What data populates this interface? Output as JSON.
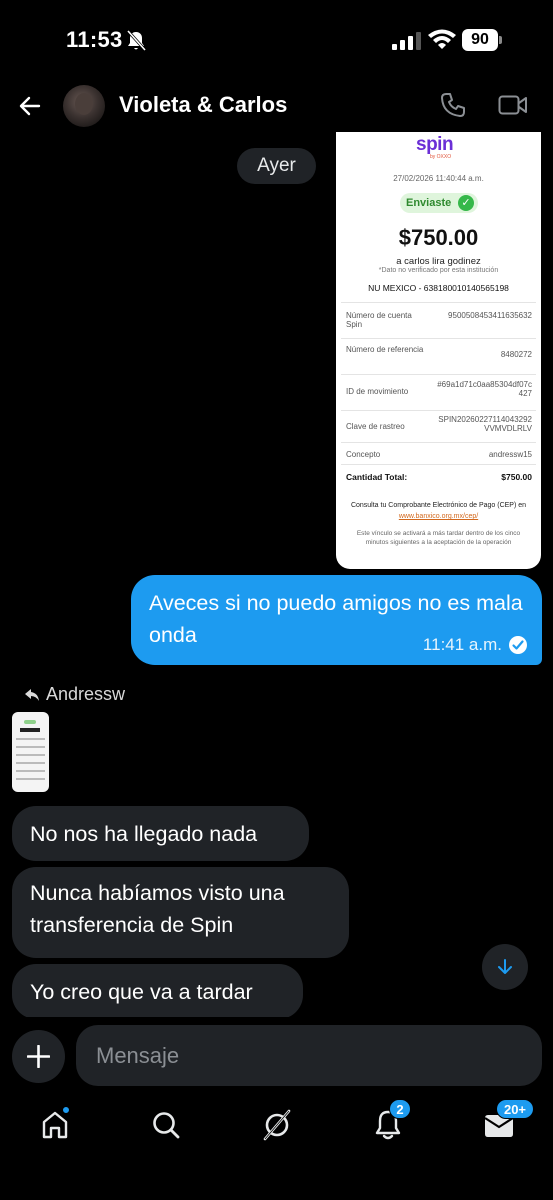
{
  "status": {
    "time": "11:53",
    "battery": "90"
  },
  "header": {
    "title": "Violeta & Carlos"
  },
  "chat": {
    "date_separator": "Ayer",
    "receipt": {
      "logo": "spin",
      "logo_sub": "by OXXO",
      "datetime": "27/02/2026 11:40:44 a.m.",
      "status": "Enviaste",
      "amount": "$750.00",
      "recipient": "a carlos lira godinez",
      "note": "*Dato no verificado por esta institución",
      "bank": "NU MEXICO - 638180010140565198",
      "rows": [
        {
          "key": "Número de cuenta Spin",
          "value": "9500508453411635632"
        },
        {
          "key": "Número de referencia",
          "value": "8480272"
        },
        {
          "key": "ID de movimiento",
          "value": "#69a1d71c0aa85304df07c427"
        },
        {
          "key": "Clave de rastreo",
          "value": "SPIN20260227114043292VVMVDLRLV"
        },
        {
          "key": "Concepto",
          "value": "andressw15"
        }
      ],
      "total_label": "Cantidad Total:",
      "total_value": "$750.00",
      "consult_text": "Consulta tu Comprobante Electrónico de Pago (CEP) en",
      "consult_link": "www.banxico.org.mx/cep/",
      "footer": "Este vínculo se activará a más tardar dentro de los cinco minutos siguientes a la aceptación de la operación"
    },
    "outgoing": {
      "text": "Aveces si no puedo amigos no es mala onda",
      "time": "11:41 a.m."
    },
    "reply_label": "Andressw",
    "incoming": [
      "No nos ha llegado nada",
      "Nunca habíamos visto una transferencia de Spin",
      "Yo creo que va a tardar"
    ]
  },
  "composer": {
    "placeholder": "Mensaje"
  },
  "nav": {
    "notifications_count": "2",
    "messages_count": "20+"
  },
  "colors": {
    "accent": "#1d9bf0",
    "bubble_incoming": "#202327",
    "background": "#000000"
  }
}
